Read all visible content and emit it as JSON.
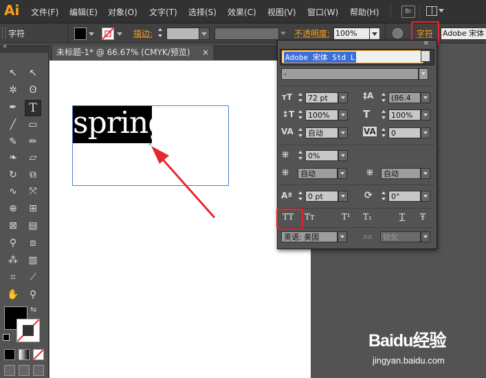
{
  "app": {
    "logo": "Ai"
  },
  "menubar": {
    "items": [
      "文件(F)",
      "编辑(E)",
      "对象(O)",
      "文字(T)",
      "选择(S)",
      "效果(C)",
      "视图(V)",
      "窗口(W)",
      "帮助(H)"
    ],
    "bridge_label": "Br"
  },
  "control_bar": {
    "label": "字符",
    "stroke_label": "描边:",
    "opacity_label": "不透明度:",
    "opacity_value": "100%",
    "character_link": "字符",
    "font_field": "Adobe 宋体"
  },
  "document": {
    "tab_title": "未标题-1* @ 66.67% (CMYK/预览)",
    "close_glyph": "×",
    "text_content": "spring"
  },
  "character_panel": {
    "menu_glyph": "≡",
    "font_family": "Adobe 宋体 Std L",
    "font_style": "-",
    "font_size": "72 pt",
    "leading": "(86.4",
    "vertical_scale": "100%",
    "horizontal_scale": "100%",
    "kerning": "自动",
    "tracking": "0",
    "tsume": "0%",
    "aki_left": "自动",
    "aki_right": "自动",
    "baseline_shift": "0 pt",
    "rotation": "0°",
    "language": "英语: 美国",
    "antialias_label": "aa",
    "antialias": "锐化",
    "style_buttons": [
      "TT",
      "Tт",
      "T¹",
      "T₁",
      "T",
      "Ŧ"
    ]
  },
  "watermark": {
    "brand": "Baidu经验",
    "url": "jingyan.baidu.com"
  },
  "colors": {
    "accent_orange": "#f7a11a",
    "highlight_red": "#e8262e",
    "selection_blue": "#4a7fd4"
  }
}
